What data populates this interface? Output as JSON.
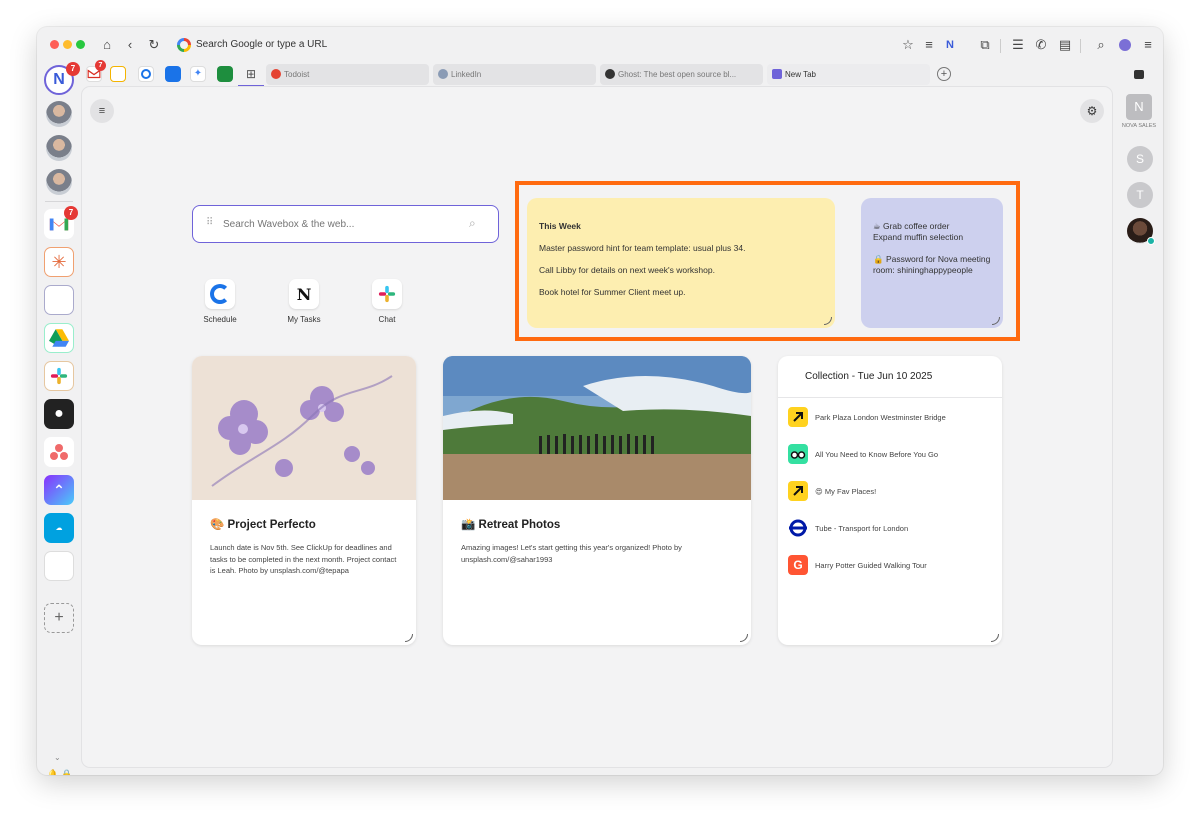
{
  "toolbar": {
    "url_placeholder": "Search Google or type a URL"
  },
  "tabs": [
    {
      "label": "Todoist"
    },
    {
      "label": "LinkedIn"
    },
    {
      "label": "Ghost: The best open source bl..."
    },
    {
      "label": "New Tab"
    }
  ],
  "sidebar_left": {
    "wavebox_badge": "7",
    "gmail_badge": "7",
    "gmail_tab_badge": "7"
  },
  "sidebar_right": {
    "group_letter": "N",
    "group_label": "NOVA SALES",
    "user1": "S",
    "user2": "T"
  },
  "search": {
    "placeholder": "Search Wavebox & the web..."
  },
  "shortcuts": [
    {
      "label": "Schedule"
    },
    {
      "label": "My Tasks"
    },
    {
      "label": "Chat"
    }
  ],
  "note_yellow": {
    "title": "This Week",
    "line1": "Master password hint for team template: usual plus 34.",
    "line2": "Call Libby for details on next week's workshop.",
    "line3": "Book hotel for Summer Client meet up."
  },
  "note_purple": {
    "line1": "☕ Grab coffee order",
    "line2": "Expand muffin selection",
    "line3": "🔒 Password for Nova meeting room: shininghappypeople"
  },
  "card_project": {
    "title": "🎨 Project Perfecto",
    "body": "Launch date is Nov 5th. See ClickUp for deadlines and tasks to be completed in the next month. Project contact is Leah. Photo by unsplash.com/@tepapa"
  },
  "card_retreat": {
    "title": "📸 Retreat Photos",
    "body": "Amazing images! Let's start getting this year's organized! Photo by unsplash.com/@sahar1993"
  },
  "collection": {
    "title": "Collection - Tue Jun 10 2025",
    "items": [
      {
        "label": "Park Plaza London Westminster Bridge"
      },
      {
        "label": "All You Need to Know Before You Go"
      },
      {
        "label": "😍 My Fav Places!"
      },
      {
        "label": "Tube - Transport for London"
      },
      {
        "label": "Harry Potter Guided Walking Tour"
      }
    ]
  },
  "colors": {
    "accent": "#6f63d9",
    "highlight": "#ff6a10",
    "note_yellow": "#fdeeb0",
    "note_purple": "#cdd0ee"
  }
}
